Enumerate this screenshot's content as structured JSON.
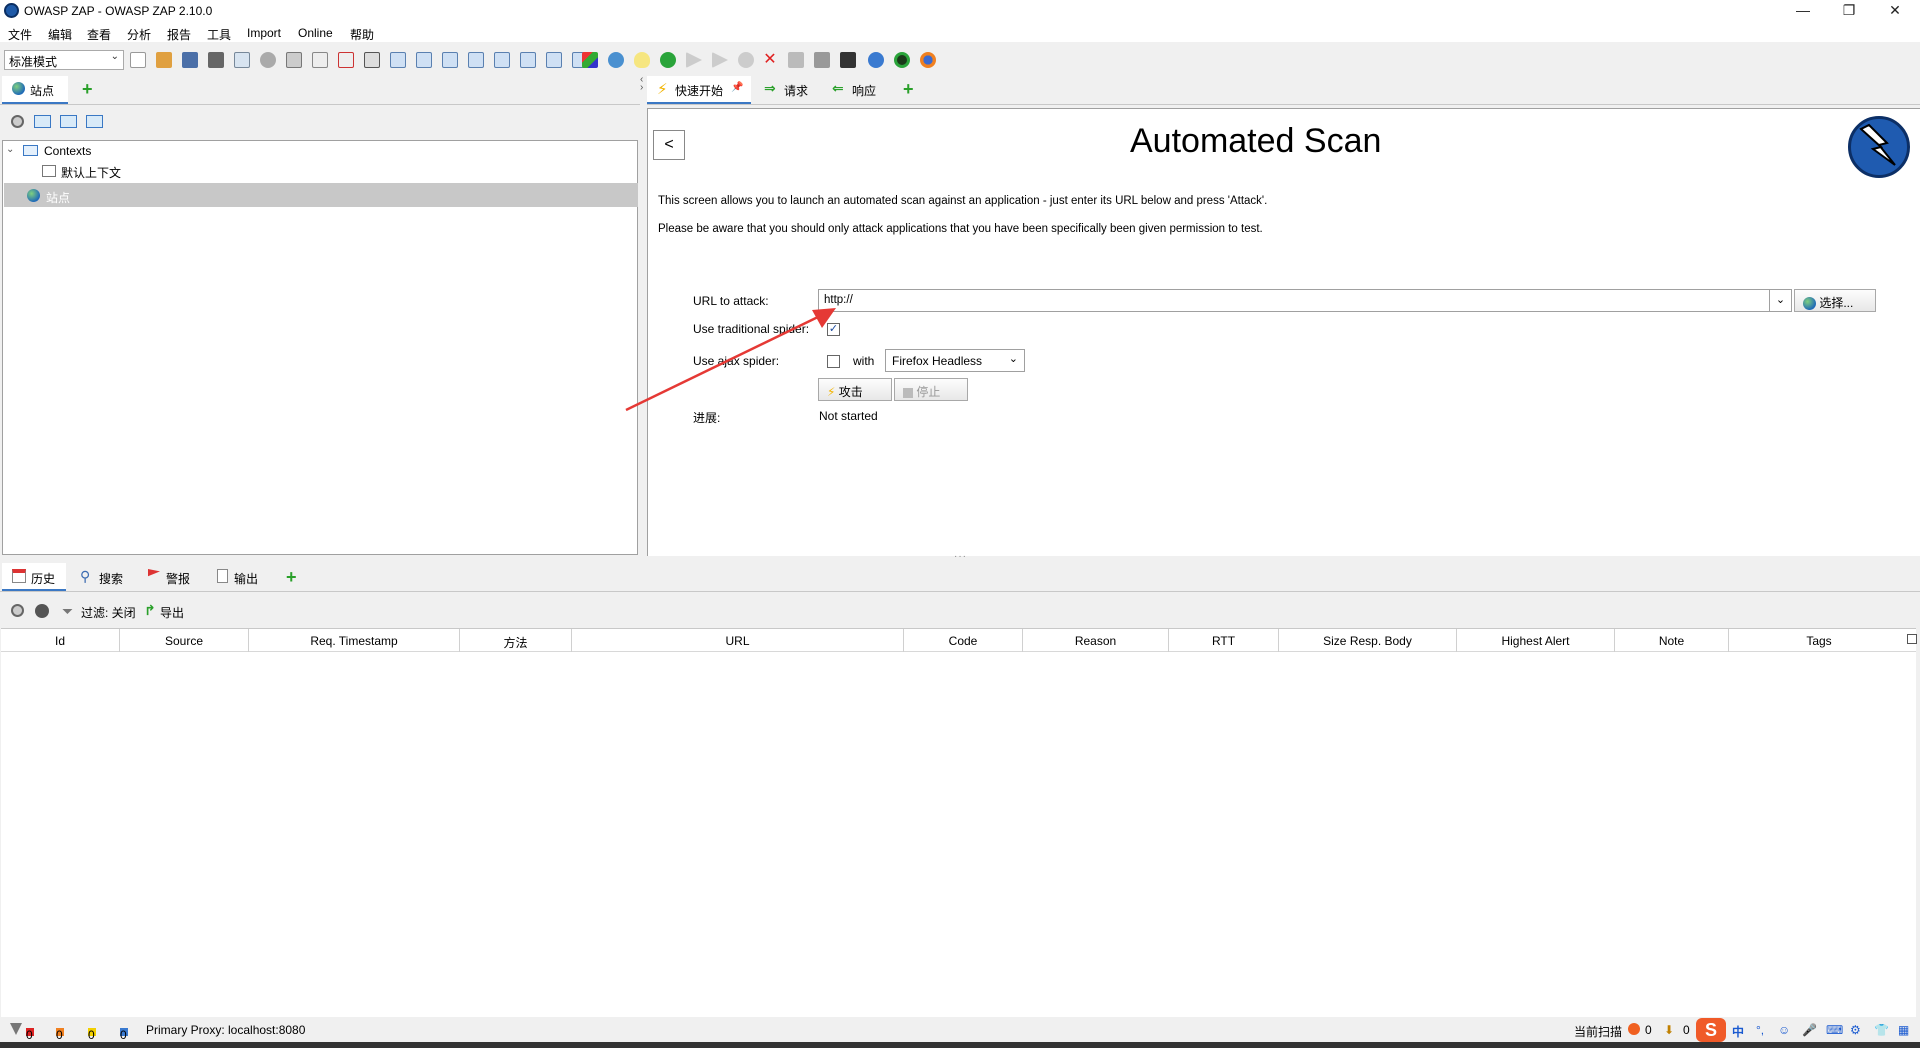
{
  "window": {
    "title": "OWASP ZAP - OWASP ZAP 2.10.0",
    "controls": [
      "—",
      "❐",
      "✕"
    ]
  },
  "menu": [
    "文件",
    "编辑",
    "查看",
    "分析",
    "报告",
    "工具",
    "Import",
    "Online",
    "帮助"
  ],
  "toolbar": {
    "mode": "标准模式"
  },
  "left_panel": {
    "tab_label": "站点",
    "tree": {
      "contexts_label": "Contexts",
      "default_context_label": "默认上下文",
      "sites_label": "站点"
    }
  },
  "right_panel": {
    "tabs": [
      {
        "label": "快速开始"
      },
      {
        "label": "请求"
      },
      {
        "label": "响应"
      }
    ],
    "back_label": "<",
    "title": "Automated Scan",
    "intro": "This screen allows you to launch an automated scan against  an application - just enter its URL below and press 'Attack'.",
    "warning": "Please be aware that you should only attack applications that you have been specifically been given permission to test.",
    "form": {
      "url_label": "URL to attack:",
      "url_value": "http://",
      "select_label": "选择...",
      "traditional_label": "Use traditional spider:",
      "traditional_checked": true,
      "ajax_label": "Use ajax spider:",
      "ajax_checked": false,
      "with_label": "with",
      "browser": "Firefox Headless",
      "attack_label": "攻击",
      "stop_label": "停止",
      "progress_label": "进展:",
      "progress_value": "Not started"
    }
  },
  "bottom_panel": {
    "tabs": [
      {
        "label": "历史"
      },
      {
        "label": "搜索"
      },
      {
        "label": "警报"
      },
      {
        "label": "输出"
      }
    ],
    "filter_label": "过滤: 关闭",
    "export_label": "导出",
    "columns": [
      "Id",
      "Source",
      "Req. Timestamp",
      "方法",
      "URL",
      "Code",
      "Reason",
      "RTT",
      "Size Resp. Body",
      "Highest Alert",
      "Note",
      "Tags"
    ]
  },
  "status_bar": {
    "alerts": [
      "0",
      "0",
      "0",
      "0"
    ],
    "proxy": "Primary Proxy: localhost:8080",
    "current_scans": "当前扫描",
    "scan_counts": [
      "0",
      "0"
    ],
    "ime_lang": "中"
  },
  "colors": {
    "accent": "#3b78c4",
    "selection": "#c8c8c8",
    "arrow": "#e53935"
  }
}
